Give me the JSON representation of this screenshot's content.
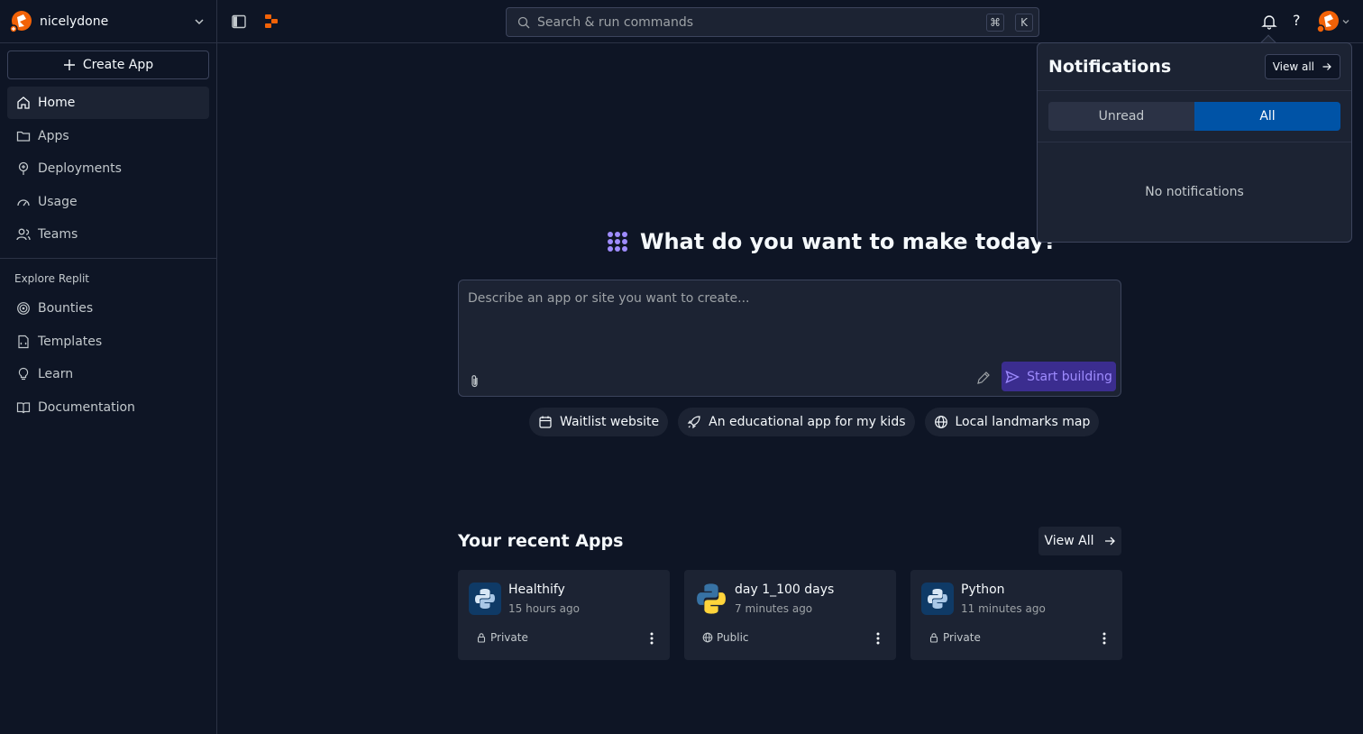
{
  "account": {
    "name": "nicelydone"
  },
  "sidebar": {
    "create_label": "Create App",
    "items": [
      {
        "label": "Home",
        "icon": "home-icon"
      },
      {
        "label": "Apps",
        "icon": "folder-icon"
      },
      {
        "label": "Deployments",
        "icon": "deploy-icon"
      },
      {
        "label": "Usage",
        "icon": "gauge-icon"
      },
      {
        "label": "Teams",
        "icon": "users-icon"
      }
    ],
    "explore_label": "Explore Replit",
    "explore_items": [
      {
        "label": "Bounties",
        "icon": "target-icon"
      },
      {
        "label": "Templates",
        "icon": "template-icon"
      },
      {
        "label": "Learn",
        "icon": "lightbulb-icon"
      },
      {
        "label": "Documentation",
        "icon": "book-icon"
      }
    ]
  },
  "topbar": {
    "search_placeholder": "Search & run commands",
    "kbd_cmd": "⌘",
    "kbd_key": "K",
    "help": "?"
  },
  "notifications": {
    "title": "Notifications",
    "view_all": "View all",
    "tabs": [
      "Unread",
      "All"
    ],
    "selected_tab": "All",
    "empty": "No notifications"
  },
  "main": {
    "headline": "What do you want to make today?",
    "prompt_placeholder": "Describe an app or site you want to create...",
    "start_label": "Start building",
    "suggestions": [
      {
        "label": "Waitlist website",
        "icon": "calendar-icon"
      },
      {
        "label": "An educational app for my kids",
        "icon": "rocket-icon"
      },
      {
        "label": "Local landmarks map",
        "icon": "globe-icon"
      }
    ],
    "recent_title": "Your recent Apps",
    "view_all": "View All",
    "apps": [
      {
        "name": "Healthify",
        "time": "15 hours ago",
        "visibility": "Private"
      },
      {
        "name": "day 1_100 days",
        "time": "7 minutes ago",
        "visibility": "Public"
      },
      {
        "name": "Python",
        "time": "11 minutes ago",
        "visibility": "Private"
      }
    ]
  },
  "colors": {
    "background": "#0e1525",
    "surface": "#1c2333",
    "accent_blue": "#0053a6",
    "accent_purple": "#3b2d8f",
    "brand_orange": "#f26207"
  }
}
